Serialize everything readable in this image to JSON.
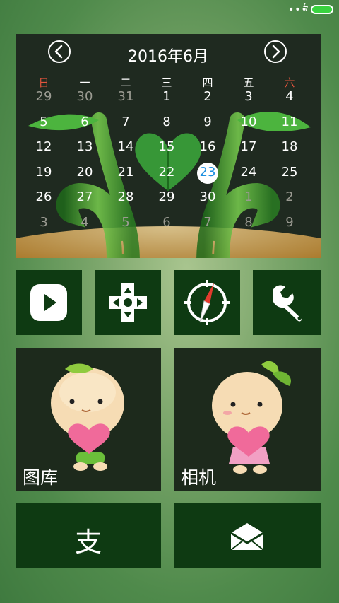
{
  "status_bar": {
    "signal": "•••",
    "charging": "ϟ"
  },
  "calendar": {
    "title": "2016年6月",
    "weekdays": [
      "日",
      "一",
      "二",
      "三",
      "四",
      "五",
      "六"
    ],
    "weeks": [
      [
        "29",
        "30",
        "31",
        "1",
        "2",
        "3",
        "4"
      ],
      [
        "5",
        "6",
        "7",
        "8",
        "9",
        "10",
        "11"
      ],
      [
        "12",
        "13",
        "14",
        "15",
        "16",
        "17",
        "18"
      ],
      [
        "19",
        "20",
        "21",
        "22",
        "23",
        "24",
        "25"
      ],
      [
        "26",
        "27",
        "28",
        "29",
        "30",
        "1",
        "2"
      ],
      [
        "3",
        "4",
        "5",
        "6",
        "7",
        "8",
        "9"
      ]
    ],
    "today": "23"
  },
  "apps": {
    "video": "play-icon",
    "game": "gamepad-icon",
    "compass": "compass-icon",
    "settings": "wrench-icon",
    "gallery_label": "图库",
    "camera_label": "相机",
    "alipay_char": "支",
    "mail": "mail-icon"
  },
  "colors": {
    "tile": "#0e3a12",
    "tile_dark": "#1d2a1c",
    "today": "#1c8fe0",
    "weekend": "#e5553d"
  }
}
